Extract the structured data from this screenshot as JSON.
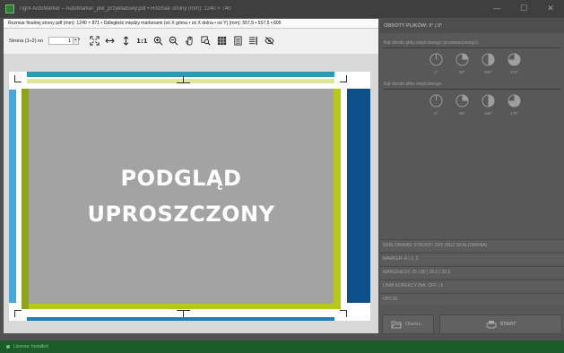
{
  "window": {
    "title": "Tlgr4 AutoMarker – AutoMarker_plik_przykładowy.pdf • Rozmiar strony (mm): 1240 × 740",
    "minimize": "—",
    "maximize": "☐",
    "close": "✕"
  },
  "info_bar": {
    "text": "Rozmiar finalnej strony pdf (mm): 1240 × 871 • Odległość między markerami (oś X górna • oś X dolna • oś Y) (mm): 557,5 • 557,5 • 805"
  },
  "toolbar": {
    "page_label": "Strona (1÷2) nn",
    "page_value": "1",
    "spin": "▲▼",
    "one_to_one": "1:1"
  },
  "preview": {
    "line1": "PODGLĄD",
    "line2": "UPROSZCZONY"
  },
  "colors": {
    "cyan": "#2b9ab5",
    "navy": "#0d4f8b",
    "lime": "#b8c81a",
    "lime_dark": "#8fa21c",
    "light_blue": "#4aa6d6",
    "gray": "#a3a3a3"
  },
  "side": {
    "header": "OBROTY PLIKÓW: 0° | 0°",
    "group1_label": "Kąt obrotu pliku wejściowego (przetwarzanego)",
    "group2_label": "Kąt obrotu pliku wejściowego",
    "angles": [
      "0°",
      "90°",
      "180°",
      "270°"
    ],
    "options": [
      "SKALOWANIE STRONY: OFF (BEZ SKALOWANIA)",
      "MARKER: A | 1, 3",
      "MARGINESY: 25 | 80 | 20,5 | 20,5",
      "LINIA KOREKCYJNA: OFF | 6",
      "OPCJE"
    ],
    "open_button": "Otwórz...",
    "start_button": "START"
  },
  "status": {
    "text": "License: Installed"
  }
}
